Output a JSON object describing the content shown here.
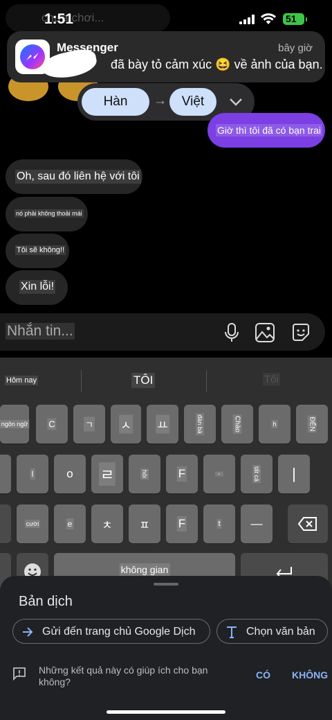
{
  "status_bar": {
    "time": "1:51",
    "battery": "51",
    "behind_text": "chưa chơi..."
  },
  "notification": {
    "app": "Messenger",
    "time": "bây giờ",
    "body": "đã bày tỏ cảm xúc 😆 về ảnh của bạn."
  },
  "translate_bar": {
    "from": "Hàn",
    "to": "Việt",
    "arrow": "→"
  },
  "messages": [
    {
      "dir": "sent",
      "text": "Giờ thì tôi đã có bạn trai"
    },
    {
      "dir": "recv",
      "text": "Oh, sau đó liên hệ với tôi"
    },
    {
      "dir": "recv",
      "text": "nó phải không thoải mái"
    },
    {
      "dir": "recv",
      "text": "Tôi sẽ không!!"
    },
    {
      "dir": "recv",
      "text": "Xin lỗi!"
    }
  ],
  "composer": {
    "placeholder": "Nhắn tin..."
  },
  "keyboard": {
    "suggestions": [
      "Hôm nay",
      "TÔI",
      "Tôi"
    ],
    "row1": [
      "ngôn ngữ",
      "C",
      "ㄱ",
      "ㅅ",
      "ㅛ",
      "đàn bà",
      "Chào",
      "h",
      "ĐẾN"
    ],
    "row2": [
      "l",
      "o",
      "ㄹ",
      "hỏi",
      "F",
      "-",
      "tất cả",
      "|"
    ],
    "row3": [
      "cười",
      "e",
      "ㅊ",
      "ㅍ",
      "F",
      "t",
      "—"
    ],
    "space": "không gian"
  },
  "sheet": {
    "title": "Bản dịch",
    "send_button": "Gửi đến trang chủ Google Dịch",
    "select_button": "Chọn văn bản",
    "feedback_question": "Những kết quả này có giúp ích cho bạn không?",
    "yes": "CÓ",
    "no": "KHÔNG"
  },
  "colors": {
    "sent_bubble": "#7b3fe4",
    "recv_bubble": "#262626",
    "accent": "#8ab4f8"
  }
}
